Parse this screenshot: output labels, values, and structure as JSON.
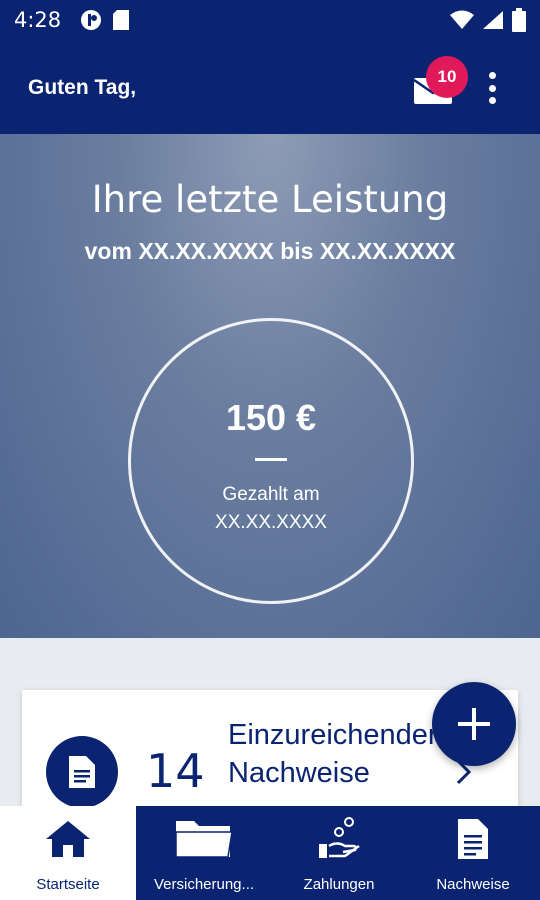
{
  "status_bar": {
    "time": "4:28"
  },
  "app_bar": {
    "greeting": "Guten Tag,",
    "notification_count": "10"
  },
  "hero": {
    "title": "Ihre letzte Leistung",
    "subtitle": "vom XX.XX.XXXX bis XX.XX.XXXX",
    "amount": "150 €",
    "paid_label": "Gezahlt am",
    "paid_date": "XX.XX.XXXX"
  },
  "card": {
    "count": "14",
    "title": "Einzureichender Nachweise"
  },
  "nav": {
    "items": [
      {
        "label": "Startseite",
        "icon": "home-icon",
        "active": true
      },
      {
        "label": "Versicherung...",
        "icon": "folder-icon",
        "active": false
      },
      {
        "label": "Zahlungen",
        "icon": "payment-hand-icon",
        "active": false
      },
      {
        "label": "Nachweise",
        "icon": "document-icon",
        "active": false
      }
    ]
  },
  "colors": {
    "primary": "#0a2472",
    "badge": "#e0195a",
    "background": "#e8ebef"
  }
}
